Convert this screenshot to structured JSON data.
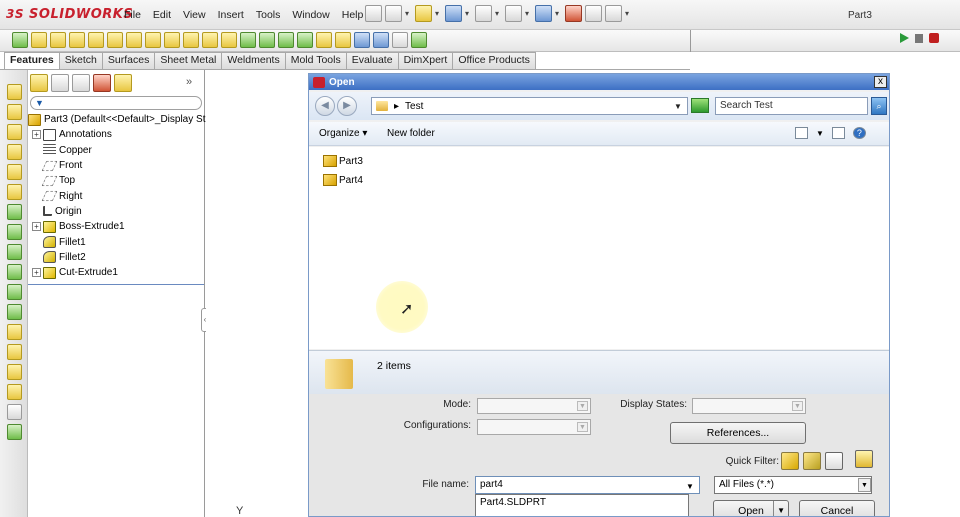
{
  "app": {
    "logo": "SOLIDWORKS",
    "logo_prefix": "3S",
    "menus": [
      "File",
      "Edit",
      "View",
      "Insert",
      "Tools",
      "Window",
      "Help"
    ],
    "document_title": "Part3"
  },
  "command_tabs": [
    "Features",
    "Sketch",
    "Surfaces",
    "Sheet Metal",
    "Weldments",
    "Mold Tools",
    "Evaluate",
    "DimXpert",
    "Office Products"
  ],
  "active_tab": "Features",
  "feature_tree": {
    "root": "Part3  (Default<<Default>_Display St",
    "items": [
      {
        "label": "Annotations",
        "icon": "annotations-icon",
        "expandable": true
      },
      {
        "label": "Copper",
        "icon": "material-icon",
        "expandable": false
      },
      {
        "label": "Front",
        "icon": "plane-icon",
        "expandable": false
      },
      {
        "label": "Top",
        "icon": "plane-icon",
        "expandable": false
      },
      {
        "label": "Right",
        "icon": "plane-icon",
        "expandable": false
      },
      {
        "label": "Origin",
        "icon": "origin-icon",
        "expandable": false
      },
      {
        "label": "Boss-Extrude1",
        "icon": "extrude-icon",
        "expandable": true
      },
      {
        "label": "Fillet1",
        "icon": "fillet-icon",
        "expandable": false
      },
      {
        "label": "Fillet2",
        "icon": "fillet-icon",
        "expandable": false
      },
      {
        "label": "Cut-Extrude1",
        "icon": "cut-extrude-icon",
        "expandable": true
      }
    ]
  },
  "graphics": {
    "axis_label": "Y"
  },
  "dialog": {
    "title": "Open",
    "close_glyph": "x",
    "address": {
      "separator": "▸",
      "current_folder": "Test"
    },
    "search_placeholder": "Search Test",
    "toolbar": {
      "organize": "Organize",
      "new_folder": "New folder"
    },
    "files": [
      "Part3",
      "Part4"
    ],
    "item_count": "2 items",
    "mode_label": "Mode:",
    "configurations_label": "Configurations:",
    "display_states_label": "Display States:",
    "references_button": "References...",
    "quick_filter_label": "Quick Filter:",
    "file_name_label": "File name:",
    "file_name_value": "part4",
    "file_type_value": "All Files (*.*)",
    "autocomplete": [
      "Part4.SLDPRT"
    ],
    "open_button": "Open",
    "cancel_button": "Cancel"
  },
  "colors": {
    "accent_blue": "#3d6fc4",
    "logo_red": "#c8202d",
    "cursor_highlight": "#fff8aa"
  }
}
